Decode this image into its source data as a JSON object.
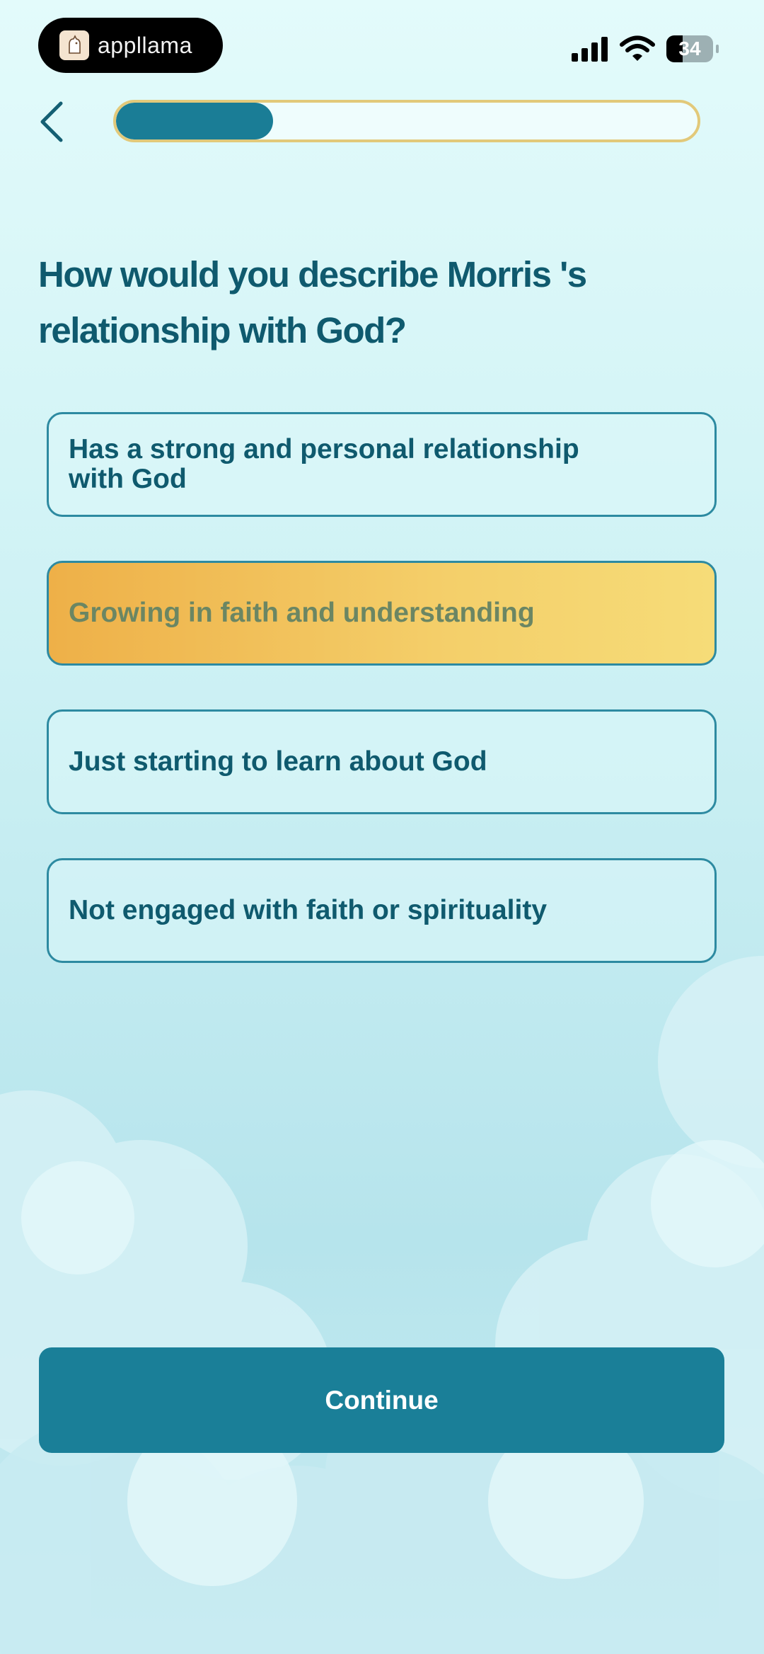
{
  "status_bar": {
    "app_pill_label": "appllama",
    "battery": "34"
  },
  "progress": {
    "value_percent": 27
  },
  "question": "How would you describe Morris 's relationship with God?",
  "options": [
    {
      "label": "Has a strong and personal relationship with God",
      "selected": false
    },
    {
      "label": "Growing in faith and understanding",
      "selected": true
    },
    {
      "label": "Just starting to learn about God",
      "selected": false
    },
    {
      "label": "Not engaged with faith or spirituality",
      "selected": false
    }
  ],
  "continue_label": "Continue",
  "colors": {
    "primary": "#1a7f98",
    "text": "#0f5a6e",
    "selected_start": "#eeb048",
    "selected_end": "#f6dc78",
    "progress_border": "#e2c97a"
  }
}
